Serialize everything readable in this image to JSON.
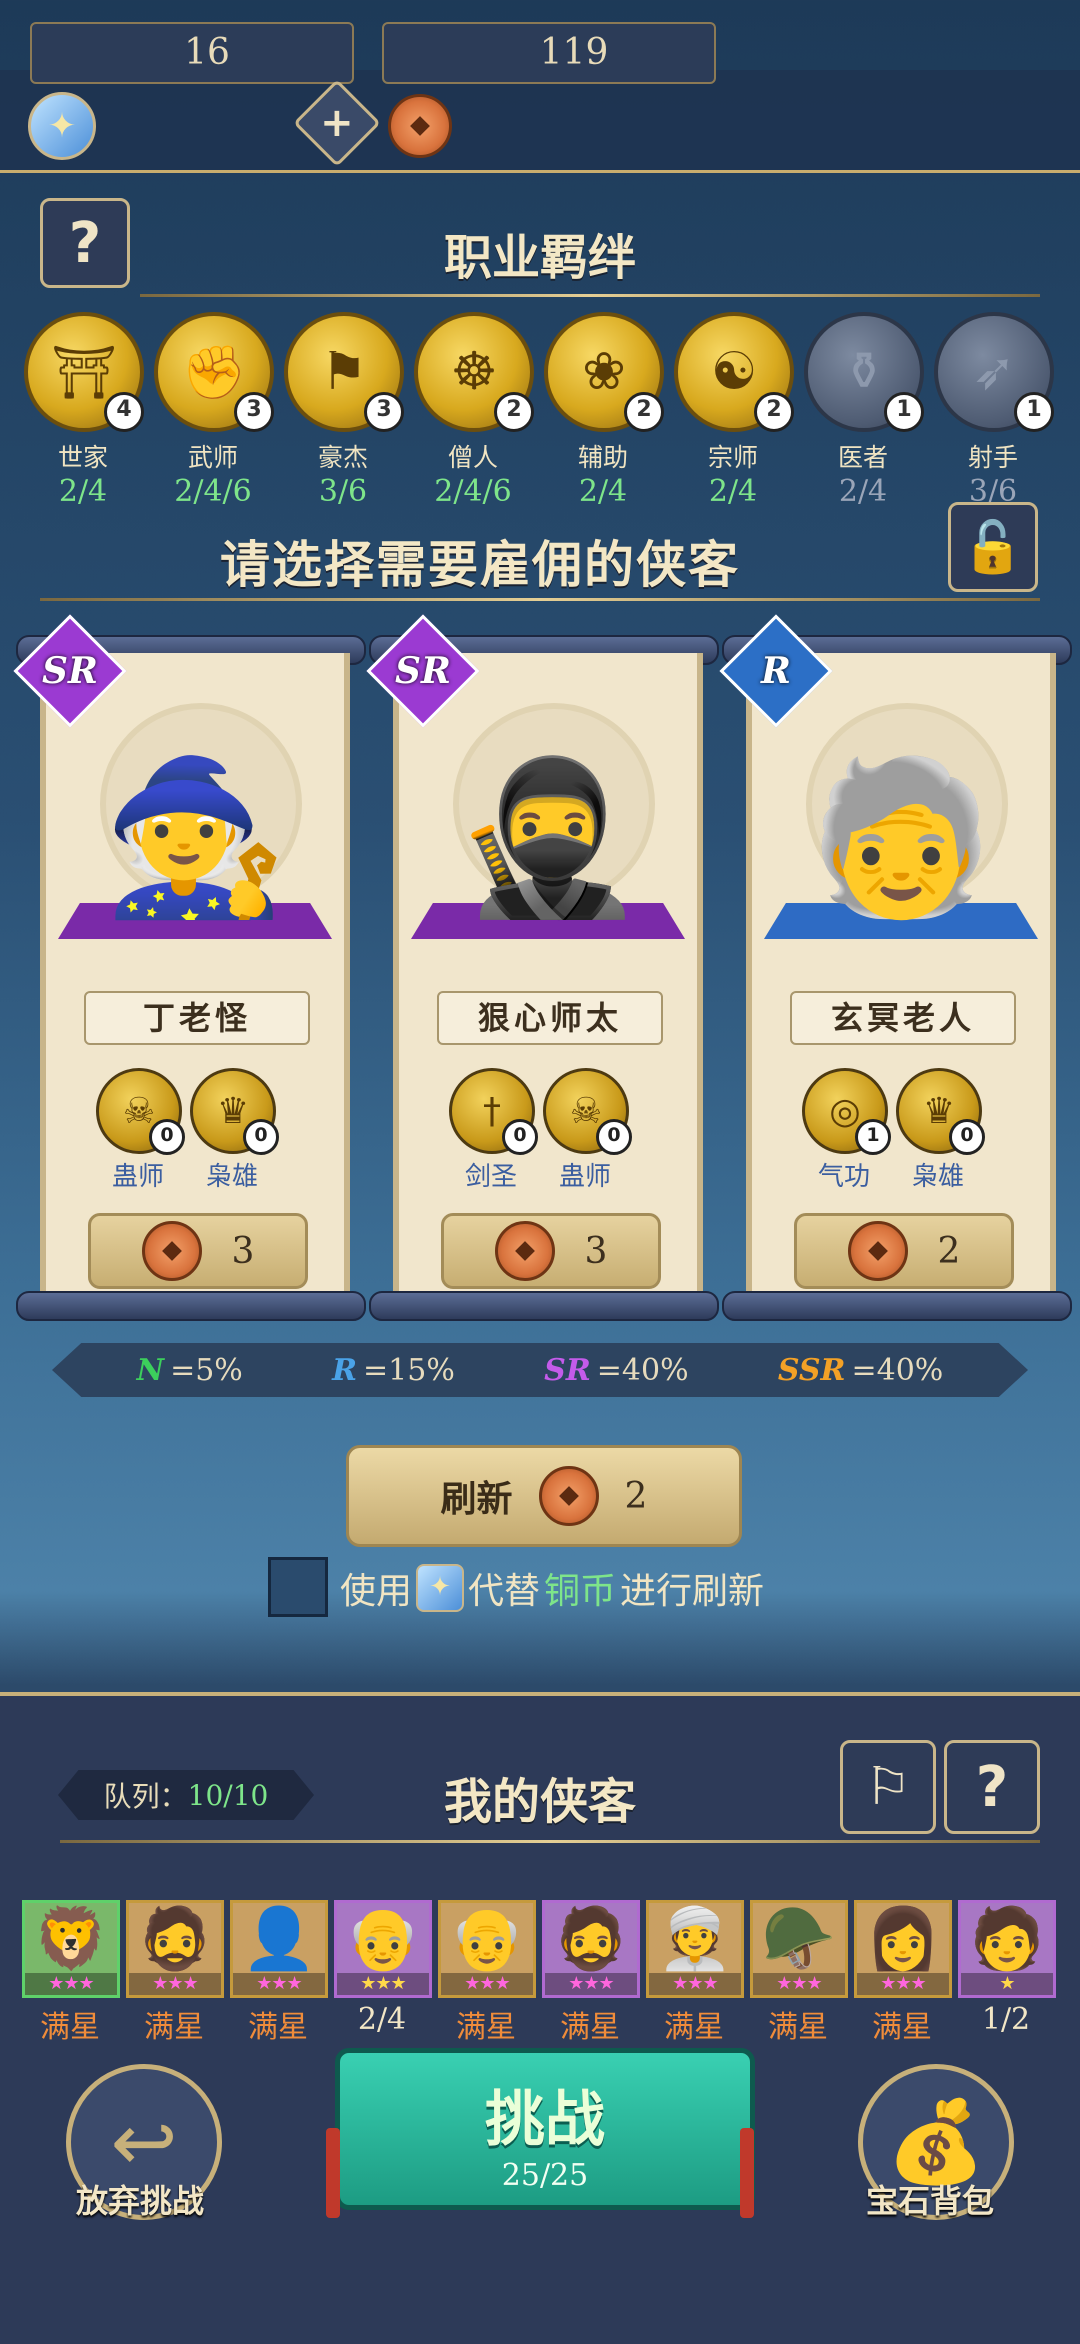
{
  "resources": {
    "ticket_count": "16",
    "coin_count": "119"
  },
  "bonds_title": "职业羁绊",
  "bonds": [
    {
      "name": "世家",
      "progress": "2/4",
      "level": "4",
      "icon": "gate-icon",
      "active": true
    },
    {
      "name": "武师",
      "progress": "2/4/6",
      "level": "3",
      "icon": "fist-icon",
      "active": true
    },
    {
      "name": "豪杰",
      "progress": "3/6",
      "level": "3",
      "icon": "flag-icon",
      "active": true
    },
    {
      "name": "僧人",
      "progress": "2/4/6",
      "level": "2",
      "icon": "prayer-beads-icon",
      "active": true
    },
    {
      "name": "辅助",
      "progress": "2/4",
      "level": "2",
      "icon": "lotus-icon",
      "active": true
    },
    {
      "name": "宗师",
      "progress": "2/4",
      "level": "2",
      "icon": "dragon-icon",
      "active": true
    },
    {
      "name": "医者",
      "progress": "2/4",
      "level": "1",
      "icon": "gourd-icon",
      "active": false
    },
    {
      "name": "射手",
      "progress": "3/6",
      "level": "1",
      "icon": "bow-icon",
      "active": false
    }
  ],
  "hire_title": "请选择需要雇佣的侠客",
  "heroes": [
    {
      "name": "丁老怪",
      "rarity": "SR",
      "price": "3",
      "tags": [
        {
          "name": "蛊师",
          "count": "0"
        },
        {
          "name": "枭雄",
          "count": "0"
        }
      ]
    },
    {
      "name": "狠心师太",
      "rarity": "SR",
      "price": "3",
      "tags": [
        {
          "name": "剑圣",
          "count": "0"
        },
        {
          "name": "蛊师",
          "count": "0"
        }
      ]
    },
    {
      "name": "玄冥老人",
      "rarity": "R",
      "price": "2",
      "tags": [
        {
          "name": "气功",
          "count": "1"
        },
        {
          "name": "枭雄",
          "count": "0"
        }
      ]
    }
  ],
  "odds": [
    {
      "label": "N",
      "value": "=5%",
      "color": "#3ccf5c"
    },
    {
      "label": "R",
      "value": "=15%",
      "color": "#4aa3e8"
    },
    {
      "label": "SR",
      "value": "=40%",
      "color": "#c35bea"
    },
    {
      "label": "SSR",
      "value": "=40%",
      "color": "#f3a126"
    }
  ],
  "refresh": {
    "label": "刷新",
    "cost": "2"
  },
  "use_ticket": {
    "prefix": "使用",
    "middle": "代替",
    "coin_word": "铜币",
    "suffix": "进行刷新"
  },
  "my_heroes": {
    "title": "我的侠客",
    "queue_label": "队列：",
    "queue_value": "10/10",
    "slots": [
      {
        "status": "满星",
        "stars": "★★★",
        "border": "#5fd16a"
      },
      {
        "status": "满星",
        "stars": "★★★",
        "border": "#c59a3c"
      },
      {
        "status": "满星",
        "stars": "★★★",
        "border": "#c59a3c"
      },
      {
        "status": "2/4",
        "stars": "★★★",
        "border": "#b06ad0"
      },
      {
        "status": "满星",
        "stars": "★★★",
        "border": "#c59a3c"
      },
      {
        "status": "满星",
        "stars": "★★★",
        "border": "#b06ad0"
      },
      {
        "status": "满星",
        "stars": "★★★",
        "border": "#c59a3c"
      },
      {
        "status": "满星",
        "stars": "★★★",
        "border": "#c59a3c"
      },
      {
        "status": "满星",
        "stars": "★★★",
        "border": "#c59a3c"
      },
      {
        "status": "1/2",
        "stars": "★",
        "border": "#b06ad0"
      }
    ]
  },
  "actions": {
    "abandon": "放弃挑战",
    "challenge": "挑战",
    "challenge_count": "25/25",
    "gem_bag": "宝石背包"
  }
}
